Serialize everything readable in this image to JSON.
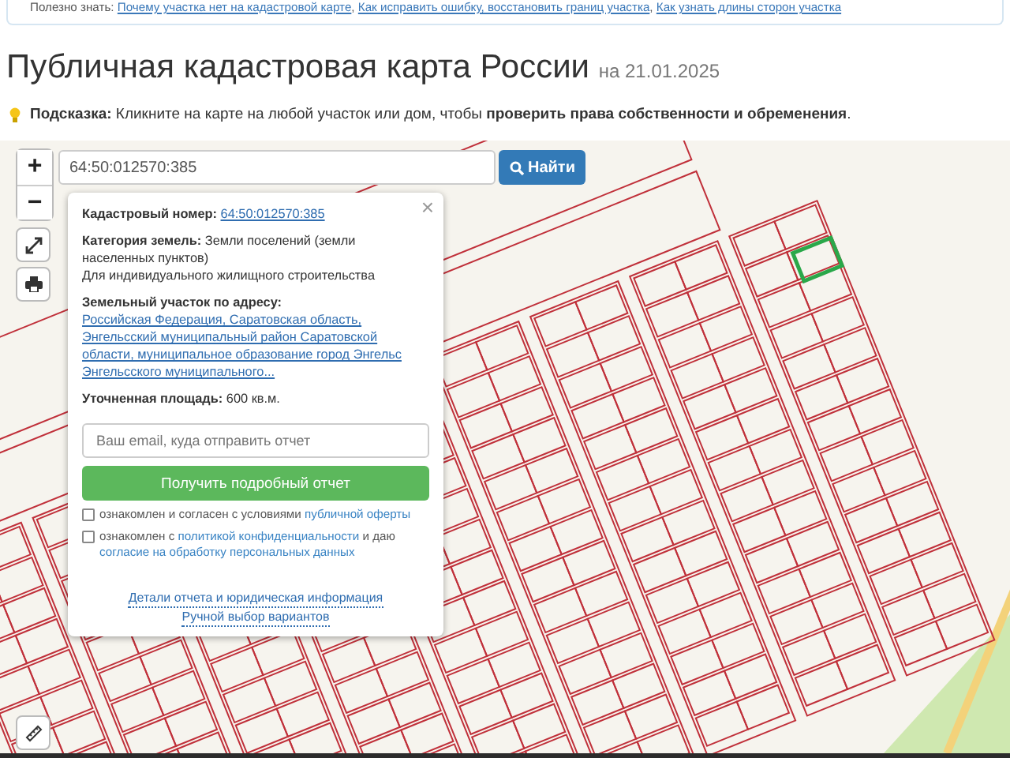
{
  "useful": {
    "label": "Полезно знать:",
    "separator": ", ",
    "links": [
      "Почему участка нет на кадастровой карте",
      "Как исправить ошибку, восстановить границ участка",
      "Как узнать длины сторон участка"
    ]
  },
  "title": "Публичная кадастровая карта России",
  "date": "на 21.01.2025",
  "hint": "**Подсказка:** Кликните на карте на любой участок или дом, чтобы **проверить права собственности и обременения**.",
  "map_controls": {
    "zoom_in": "+",
    "zoom_out": "−"
  },
  "search": {
    "value": "64:50:012570:385",
    "button": "Найти"
  },
  "popup": {
    "close": "×",
    "fields": [
      {
        "kind": "link",
        "label": "Кадастровый номер:",
        "value": "64:50:012570:385"
      },
      {
        "kind": "text",
        "label": "Категория земель:",
        "value": "Земли поселений (земли населенных пунктов)",
        "note": "Для индивидуального жилищного строительства"
      },
      {
        "kind": "link",
        "label": "Земельный участок по адресу:",
        "value": "Российская Федерация, Саратовская область, Энгельсский муниципальный район Саратовской области, муниципальное образование город Энгельс Энгельсского муниципального..."
      },
      {
        "kind": "text",
        "label": "Уточненная площадь:",
        "value": "600 кв.м."
      }
    ],
    "email": {
      "placeholder": "Ваш email, куда отправить отчет"
    },
    "submit": "Получить подробный отчет",
    "agreements": [
      {
        "checked": false,
        "parts": [
          {
            "kind": "text",
            "text": "ознакомлен и согласен с условиями "
          },
          {
            "kind": "link",
            "text": "публичной оферты"
          }
        ]
      },
      {
        "checked": false,
        "parts": [
          {
            "kind": "text",
            "text": "ознакомлен с "
          },
          {
            "kind": "link",
            "text": "политикой конфиденциальности"
          },
          {
            "kind": "text",
            "text": " и даю "
          },
          {
            "kind": "link",
            "text": "согласие на обработку персональных данных"
          }
        ]
      }
    ],
    "footer_links": [
      "Детали отчета и юридическая информация",
      "Ручной выбор вариантов"
    ]
  }
}
